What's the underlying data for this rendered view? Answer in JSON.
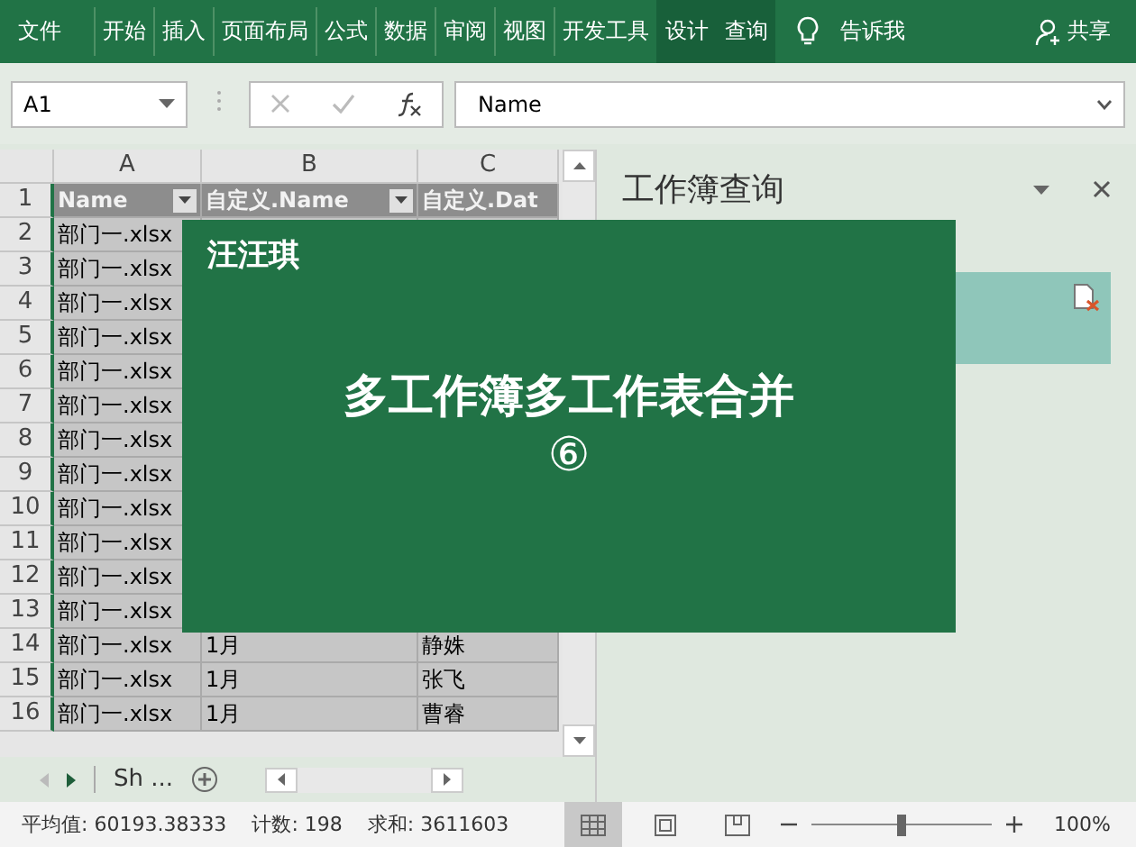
{
  "ribbon": {
    "tabs": [
      {
        "label": "文件",
        "contextual": false
      },
      {
        "label": "开始",
        "contextual": false
      },
      {
        "label": "插入",
        "contextual": false
      },
      {
        "label": "页面布局",
        "contextual": false
      },
      {
        "label": "公式",
        "contextual": false
      },
      {
        "label": "数据",
        "contextual": false
      },
      {
        "label": "审阅",
        "contextual": false
      },
      {
        "label": "视图",
        "contextual": false
      },
      {
        "label": "开发工具",
        "contextual": false
      },
      {
        "label": "设计",
        "contextual": true
      },
      {
        "label": "查询",
        "contextual": true
      }
    ],
    "tell_me": "告诉我",
    "share": "共享"
  },
  "formula_bar": {
    "name_box": "A1",
    "value": "Name"
  },
  "sheet": {
    "columns": [
      "A",
      "B",
      "C"
    ],
    "rows": [
      {
        "number": "1",
        "header": true,
        "cells": [
          "Name",
          "自定义.Name",
          "自定义.Dat"
        ]
      },
      {
        "number": "2",
        "header": false,
        "cells": [
          "部门一.xlsx"
        ]
      },
      {
        "number": "3",
        "header": false,
        "cells": [
          "部门一.xlsx"
        ]
      },
      {
        "number": "4",
        "header": false,
        "cells": [
          "部门一.xlsx"
        ]
      },
      {
        "number": "5",
        "header": false,
        "cells": [
          "部门一.xlsx"
        ]
      },
      {
        "number": "6",
        "header": false,
        "cells": [
          "部门一.xlsx"
        ]
      },
      {
        "number": "7",
        "header": false,
        "cells": [
          "部门一.xlsx"
        ]
      },
      {
        "number": "8",
        "header": false,
        "cells": [
          "部门一.xlsx"
        ]
      },
      {
        "number": "9",
        "header": false,
        "cells": [
          "部门一.xlsx"
        ]
      },
      {
        "number": "10",
        "header": false,
        "cells": [
          "部门一.xlsx"
        ]
      },
      {
        "number": "11",
        "header": false,
        "cells": [
          "部门一.xlsx"
        ]
      },
      {
        "number": "12",
        "header": false,
        "cells": [
          "部门一.xlsx"
        ]
      },
      {
        "number": "13",
        "header": false,
        "cells": [
          "部门一.xlsx"
        ]
      },
      {
        "number": "14",
        "header": false,
        "cells": [
          "部门一.xlsx",
          "1月",
          "静姝"
        ]
      },
      {
        "number": "15",
        "header": false,
        "cells": [
          "部门一.xlsx",
          "1月",
          "张飞"
        ]
      },
      {
        "number": "16",
        "header": false,
        "cells": [
          "部门一.xlsx",
          "1月",
          "曹睿"
        ]
      }
    ],
    "sheet_tab": "Sh ..."
  },
  "task_pane": {
    "title": "工作簿查询"
  },
  "overlay": {
    "author": "汪汪琪",
    "title": "多工作簿多工作表合并",
    "number": "⑥"
  },
  "status_bar": {
    "stats": [
      "平均值: 60193.38333",
      "计数: 198",
      "求和: 3611603"
    ],
    "zoom": "100%",
    "zoom_slider": {
      "level": 0.5
    }
  }
}
